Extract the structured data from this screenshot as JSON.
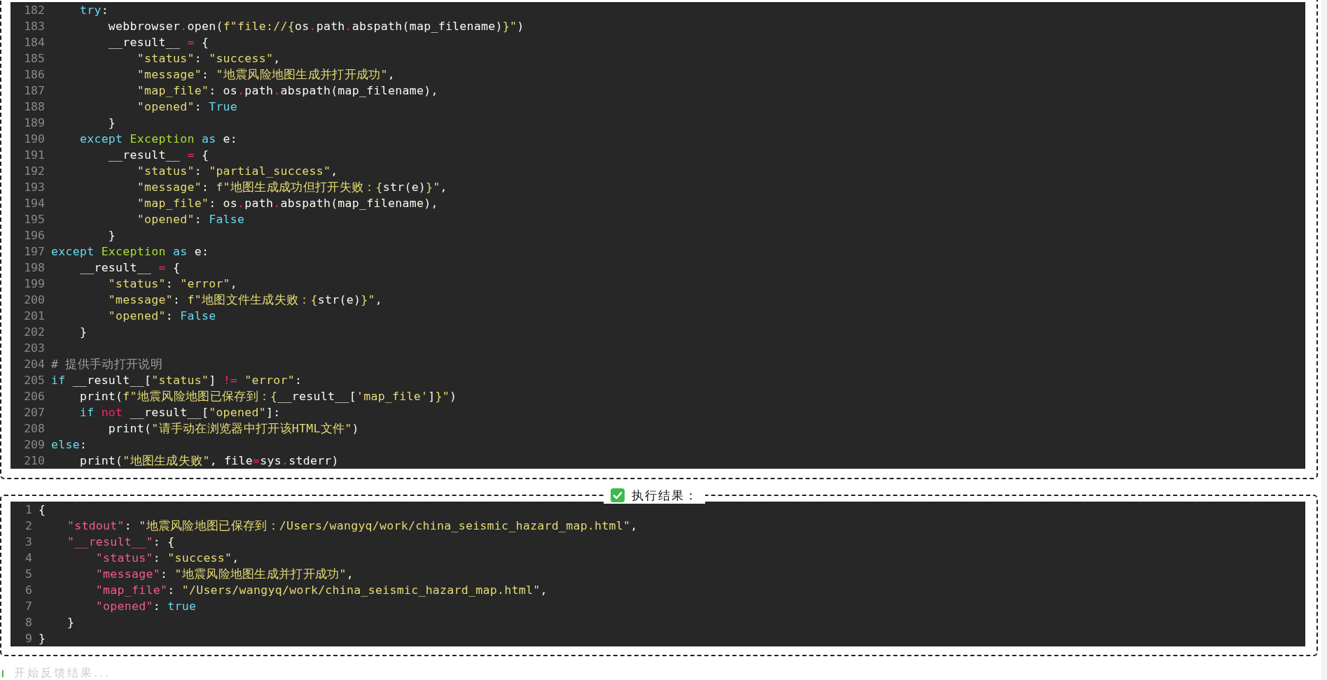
{
  "code_editor": {
    "lines": [
      {
        "number": "182",
        "tokens": [
          {
            "kind": "keyword",
            "text": "    try"
          },
          {
            "kind": "plain",
            "text": ":"
          }
        ]
      },
      {
        "number": "183",
        "tokens": [
          {
            "kind": "plain",
            "text": "        webbrowser"
          },
          {
            "kind": "operator",
            "text": "."
          },
          {
            "kind": "plain",
            "text": "open("
          },
          {
            "kind": "string",
            "text": "f\"file://{"
          },
          {
            "kind": "plain",
            "text": "os"
          },
          {
            "kind": "operator",
            "text": "."
          },
          {
            "kind": "plain",
            "text": "path"
          },
          {
            "kind": "operator",
            "text": "."
          },
          {
            "kind": "plain",
            "text": "abspath(map_filename)"
          },
          {
            "kind": "string",
            "text": "}\""
          },
          {
            "kind": "plain",
            "text": ")"
          }
        ]
      },
      {
        "number": "184",
        "tokens": [
          {
            "kind": "plain",
            "text": "        __result__ "
          },
          {
            "kind": "operator",
            "text": "="
          },
          {
            "kind": "plain",
            "text": " {"
          }
        ]
      },
      {
        "number": "185",
        "tokens": [
          {
            "kind": "string",
            "text": "            \"status\""
          },
          {
            "kind": "plain",
            "text": ": "
          },
          {
            "kind": "string",
            "text": "\"success\""
          },
          {
            "kind": "plain",
            "text": ","
          }
        ]
      },
      {
        "number": "186",
        "tokens": [
          {
            "kind": "string",
            "text": "            \"message\""
          },
          {
            "kind": "plain",
            "text": ": "
          },
          {
            "kind": "string",
            "text": "\"地震风险地图生成并打开成功\""
          },
          {
            "kind": "plain",
            "text": ","
          }
        ]
      },
      {
        "number": "187",
        "tokens": [
          {
            "kind": "string",
            "text": "            \"map_file\""
          },
          {
            "kind": "plain",
            "text": ": os"
          },
          {
            "kind": "operator",
            "text": "."
          },
          {
            "kind": "plain",
            "text": "path"
          },
          {
            "kind": "operator",
            "text": "."
          },
          {
            "kind": "plain",
            "text": "abspath(map_filename),"
          }
        ]
      },
      {
        "number": "188",
        "tokens": [
          {
            "kind": "string",
            "text": "            \"opened\""
          },
          {
            "kind": "plain",
            "text": ": "
          },
          {
            "kind": "constant",
            "text": "True"
          }
        ]
      },
      {
        "number": "189",
        "tokens": [
          {
            "kind": "plain",
            "text": "        }"
          }
        ]
      },
      {
        "number": "190",
        "tokens": [
          {
            "kind": "keyword",
            "text": "    except"
          },
          {
            "kind": "class",
            "text": " Exception"
          },
          {
            "kind": "keyword",
            "text": " as"
          },
          {
            "kind": "plain",
            "text": " e:"
          }
        ]
      },
      {
        "number": "191",
        "tokens": [
          {
            "kind": "plain",
            "text": "        __result__ "
          },
          {
            "kind": "operator",
            "text": "="
          },
          {
            "kind": "plain",
            "text": " {"
          }
        ]
      },
      {
        "number": "192",
        "tokens": [
          {
            "kind": "string",
            "text": "            \"status\""
          },
          {
            "kind": "plain",
            "text": ": "
          },
          {
            "kind": "string",
            "text": "\"partial_success\""
          },
          {
            "kind": "plain",
            "text": ","
          }
        ]
      },
      {
        "number": "193",
        "tokens": [
          {
            "kind": "string",
            "text": "            \"message\""
          },
          {
            "kind": "plain",
            "text": ": "
          },
          {
            "kind": "string",
            "text": "f\"地图生成成功但打开失败：{"
          },
          {
            "kind": "plain",
            "text": "str(e)"
          },
          {
            "kind": "string",
            "text": "}\""
          },
          {
            "kind": "plain",
            "text": ","
          }
        ]
      },
      {
        "number": "194",
        "tokens": [
          {
            "kind": "string",
            "text": "            \"map_file\""
          },
          {
            "kind": "plain",
            "text": ": os"
          },
          {
            "kind": "operator",
            "text": "."
          },
          {
            "kind": "plain",
            "text": "path"
          },
          {
            "kind": "operator",
            "text": "."
          },
          {
            "kind": "plain",
            "text": "abspath(map_filename),"
          }
        ]
      },
      {
        "number": "195",
        "tokens": [
          {
            "kind": "string",
            "text": "            \"opened\""
          },
          {
            "kind": "plain",
            "text": ": "
          },
          {
            "kind": "constant",
            "text": "False"
          }
        ]
      },
      {
        "number": "196",
        "tokens": [
          {
            "kind": "plain",
            "text": "        }"
          }
        ]
      },
      {
        "number": "197",
        "tokens": [
          {
            "kind": "keyword",
            "text": "except"
          },
          {
            "kind": "class",
            "text": " Exception"
          },
          {
            "kind": "keyword",
            "text": " as"
          },
          {
            "kind": "plain",
            "text": " e:"
          }
        ]
      },
      {
        "number": "198",
        "tokens": [
          {
            "kind": "plain",
            "text": "    __result__ "
          },
          {
            "kind": "operator",
            "text": "="
          },
          {
            "kind": "plain",
            "text": " {"
          }
        ]
      },
      {
        "number": "199",
        "tokens": [
          {
            "kind": "string",
            "text": "        \"status\""
          },
          {
            "kind": "plain",
            "text": ": "
          },
          {
            "kind": "string",
            "text": "\"error\""
          },
          {
            "kind": "plain",
            "text": ","
          }
        ]
      },
      {
        "number": "200",
        "tokens": [
          {
            "kind": "string",
            "text": "        \"message\""
          },
          {
            "kind": "plain",
            "text": ": "
          },
          {
            "kind": "string",
            "text": "f\"地图文件生成失败：{"
          },
          {
            "kind": "plain",
            "text": "str(e)"
          },
          {
            "kind": "string",
            "text": "}\""
          },
          {
            "kind": "plain",
            "text": ","
          }
        ]
      },
      {
        "number": "201",
        "tokens": [
          {
            "kind": "string",
            "text": "        \"opened\""
          },
          {
            "kind": "plain",
            "text": ": "
          },
          {
            "kind": "constant",
            "text": "False"
          }
        ]
      },
      {
        "number": "202",
        "tokens": [
          {
            "kind": "plain",
            "text": "    }"
          }
        ]
      },
      {
        "number": "203"
      },
      {
        "number": "204",
        "tokens": [
          {
            "kind": "comment",
            "text": "# 提供手动打开说明"
          }
        ]
      },
      {
        "number": "205",
        "tokens": [
          {
            "kind": "keyword",
            "text": "if"
          },
          {
            "kind": "plain",
            "text": " __result__["
          },
          {
            "kind": "string",
            "text": "\"status\""
          },
          {
            "kind": "plain",
            "text": "] "
          },
          {
            "kind": "operator",
            "text": "!="
          },
          {
            "kind": "string",
            "text": " \"error\""
          },
          {
            "kind": "plain",
            "text": ":"
          }
        ]
      },
      {
        "number": "206",
        "tokens": [
          {
            "kind": "plain",
            "text": "    print("
          },
          {
            "kind": "string",
            "text": "f\"地震风险地图已保存到：{"
          },
          {
            "kind": "plain",
            "text": "__result__["
          },
          {
            "kind": "string",
            "text": "'map_file'"
          },
          {
            "kind": "plain",
            "text": "]"
          },
          {
            "kind": "string",
            "text": "}\""
          },
          {
            "kind": "plain",
            "text": ")"
          }
        ]
      },
      {
        "number": "207",
        "tokens": [
          {
            "kind": "keyword",
            "text": "    if"
          },
          {
            "kind": "operator",
            "text": " not"
          },
          {
            "kind": "plain",
            "text": " __result__["
          },
          {
            "kind": "string",
            "text": "\"opened\""
          },
          {
            "kind": "plain",
            "text": "]:"
          }
        ]
      },
      {
        "number": "208",
        "tokens": [
          {
            "kind": "plain",
            "text": "        print("
          },
          {
            "kind": "string",
            "text": "\"请手动在浏览器中打开该HTML文件\""
          },
          {
            "kind": "plain",
            "text": ")"
          }
        ]
      },
      {
        "number": "209",
        "tokens": [
          {
            "kind": "keyword",
            "text": "else"
          },
          {
            "kind": "plain",
            "text": ":"
          }
        ]
      },
      {
        "number": "210",
        "tokens": [
          {
            "kind": "plain",
            "text": "    print("
          },
          {
            "kind": "string",
            "text": "\"地图生成失败\""
          },
          {
            "kind": "plain",
            "text": ", file"
          },
          {
            "kind": "operator",
            "text": "="
          },
          {
            "kind": "plain",
            "text": "sys"
          },
          {
            "kind": "operator",
            "text": "."
          },
          {
            "kind": "plain",
            "text": "stderr)"
          }
        ]
      }
    ]
  },
  "result_panel": {
    "title": "执行结果：",
    "lines": [
      {
        "number": "1",
        "tokens": [
          {
            "kind": "plain",
            "text": "{"
          }
        ]
      },
      {
        "number": "2",
        "tokens": [
          {
            "kind": "key",
            "text": "    \"stdout\""
          },
          {
            "kind": "plain",
            "text": ": "
          },
          {
            "kind": "string",
            "text": "\"地震风险地图已保存到：/Users/wangyq/work/china_seismic_hazard_map.html\""
          },
          {
            "kind": "plain",
            "text": ","
          }
        ]
      },
      {
        "number": "3",
        "tokens": [
          {
            "kind": "key",
            "text": "    \"__result__\""
          },
          {
            "kind": "plain",
            "text": ": {"
          }
        ]
      },
      {
        "number": "4",
        "tokens": [
          {
            "kind": "key",
            "text": "        \"status\""
          },
          {
            "kind": "plain",
            "text": ": "
          },
          {
            "kind": "string",
            "text": "\"success\""
          },
          {
            "kind": "plain",
            "text": ","
          }
        ]
      },
      {
        "number": "5",
        "tokens": [
          {
            "kind": "key",
            "text": "        \"message\""
          },
          {
            "kind": "plain",
            "text": ": "
          },
          {
            "kind": "string",
            "text": "\"地震风险地图生成并打开成功\""
          },
          {
            "kind": "plain",
            "text": ","
          }
        ]
      },
      {
        "number": "6",
        "tokens": [
          {
            "kind": "key",
            "text": "        \"map_file\""
          },
          {
            "kind": "plain",
            "text": ": "
          },
          {
            "kind": "string",
            "text": "\"/Users/wangyq/work/china_seismic_hazard_map.html\""
          },
          {
            "kind": "plain",
            "text": ","
          }
        ]
      },
      {
        "number": "7",
        "tokens": [
          {
            "kind": "key",
            "text": "        \"opened\""
          },
          {
            "kind": "plain",
            "text": ": "
          },
          {
            "kind": "constant",
            "text": "true"
          }
        ]
      },
      {
        "number": "8",
        "tokens": [
          {
            "kind": "plain",
            "text": "    }"
          }
        ]
      },
      {
        "number": "9",
        "tokens": [
          {
            "kind": "plain",
            "text": "}"
          }
        ]
      }
    ]
  },
  "status_line": "开始反馈结果..."
}
